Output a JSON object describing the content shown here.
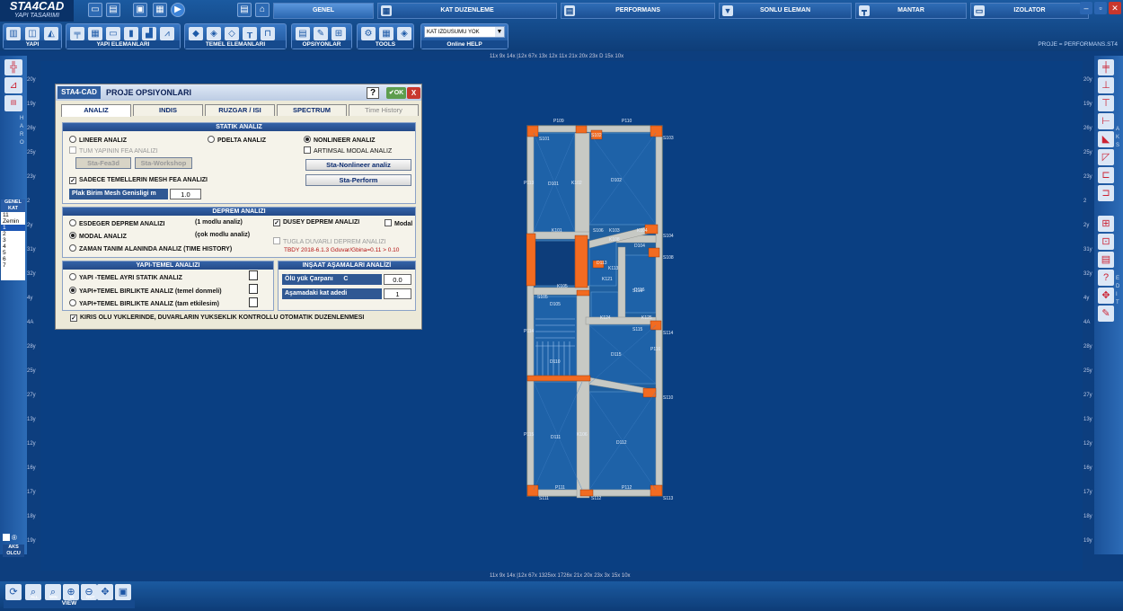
{
  "app": {
    "logo_title": "STA4CAD",
    "logo_subtitle": "YAPI TASARIMI",
    "project_label": "PROJE = PERFORMANS.ST4"
  },
  "top_tabs": [
    "GENEL",
    "KAT DUZENLEME",
    "PERFORMANS",
    "SONLU ELEMAN",
    "MANTAR",
    "IZOLATOR"
  ],
  "toolbar_groups": [
    "YAPI",
    "YAPI ELEMANLARI",
    "TEMEL ELEMANLARI",
    "OPSIYONLAR",
    "TOOLS"
  ],
  "combo": {
    "value": "KAT IZDUSUMU YOK",
    "help": "Online HELP"
  },
  "left_side": {
    "vertical_label": "H A R O",
    "kat_header": "GENEL KAT",
    "floors": [
      "11",
      "Zemin",
      "1",
      "2",
      "3",
      "4",
      "5",
      "6",
      "7"
    ],
    "selected_floor": "1",
    "aks_label": "AKS OLCU"
  },
  "right_side": {
    "label_top": "A K S",
    "label_bottom": "E D I T"
  },
  "bottom": {
    "view_label": "VIEW",
    "icon_labels": [
      "ALL",
      "WIN",
      "IN",
      "OUT"
    ]
  },
  "rulers": {
    "top": "11x  9x  14x  |12x      67x  13x 12x 11x      21x  20x   23x  D   15x  10x",
    "bottom": "11x  9x  14x  |12x      67x  1325xx 1726x       21x  20x   23x  3x  15x  10x",
    "left_labels": [
      "20y",
      "19y",
      "26y",
      "25y",
      "23y",
      "2",
      "2y",
      "31y",
      "32y",
      "4y",
      "4A",
      "28y",
      "25y",
      "27y",
      "13y",
      "12y",
      "16y",
      "17y",
      "18y",
      "19y"
    ]
  },
  "dialog": {
    "brand": "STA4-CAD",
    "title": "PROJE   OPSIYONLARI",
    "help": "?",
    "ok": "OK",
    "close": "X",
    "tabs": [
      "ANALIZ",
      "INDIS",
      "RUZGAR / ISI",
      "SPECTRUM",
      "Time History"
    ],
    "static": {
      "header": "STATIK ANALIZ",
      "lineer": "LINEER ANALIZ",
      "pdelta": "PDELTA ANALIZ",
      "nonlineer": "NONLINEER ANALIZ",
      "tum_yapi": "TUM YAPININ FEA ANALIZI",
      "artimsal": "ARTIMSAL MODAL ANALIZ",
      "fea3d": "Sta-Fea3d",
      "workshop": "Sta-Workshop",
      "nonlineer_btn": "Sta-Nonlineer analiz",
      "perform_btn": "Sta-Perform",
      "sadece": "SADECE TEMELLERIN MESH FEA ANALIZI",
      "mesh_label": "Plak Birim Mesh Genisligi m",
      "mesh_value": "1.0"
    },
    "deprem": {
      "header": "DEPREM ANALIZI",
      "esdeger": "ESDEGER  DEPREM  ANALIZI",
      "esdeger_note": "(1 modlu analiz)",
      "modal": "MODAL  ANALIZ",
      "modal_note": "(çok modlu analiz)",
      "zaman": "ZAMAN TANIM ALANINDA ANALIZ  (TIME HISTORY)",
      "dusey": "DUSEY DEPREM ANALIZI",
      "modal_chk": "Modal",
      "tugla": "TUGLA DUVARLI DEPREM ANALIZI",
      "tbdy": "TBDY 2018-6.1.3  Gduvar/Gbina=0.11 > 0.10"
    },
    "yapi_temel": {
      "header": "YAPI-TEMEL  ANALIZI",
      "ayri": "YAPI -TEMEL  AYRI  STATIK ANALIZ",
      "birlikte1": "YAPI+TEMEL BIRLIKTE  ANALIZ  (temel donmeli)",
      "birlikte2": "YAPI+TEMEL BIRLIKTE  ANALIZ  (tam  etkilesim)"
    },
    "insaat": {
      "header": "INŞAAT AŞAMALARI ANALİZİ",
      "olu_label": "Ölü yük Çarpanı",
      "olu_c": "C",
      "olu_value": "0.0",
      "asama_label": "Aşamadaki kat adedi",
      "asama_value": "1"
    },
    "kiris": "KIRIS OLU YUKLERINDE,  DUVARLARIN YUKSEKLIK KONTROLLU OTOMATIK  DUZENLENMESI"
  },
  "plan": {
    "beams": [
      "P109",
      "P110",
      "P111",
      "P112",
      "P113",
      "P114",
      "P115",
      "P116"
    ],
    "columns": [
      "S101",
      "S102",
      "S103",
      "S104",
      "S105",
      "S106",
      "S108",
      "S110",
      "S111",
      "S112",
      "S113",
      "S114",
      "S115",
      "S116"
    ],
    "slabs": [
      "D101",
      "D102",
      "D104",
      "D105",
      "D110",
      "D111",
      "D112",
      "D113",
      "D115",
      "D116"
    ],
    "beam_labels": [
      "K101",
      "K102",
      "K103",
      "K104",
      "K105",
      "K106",
      "K108",
      "K113",
      "K121",
      "K124",
      "K125"
    ]
  }
}
